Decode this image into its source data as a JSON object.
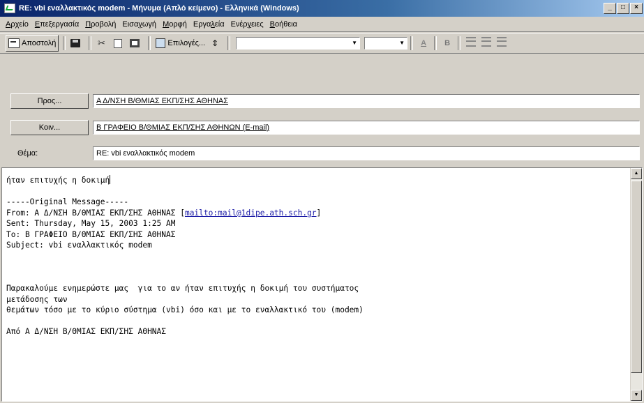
{
  "window": {
    "title": "RE: vbi εναλλακτικός modem - Μήνυμα (Απλό κείμενο) - Ελληνικά (Windows)",
    "controls": {
      "minimize": "_",
      "maximize": "□",
      "close": "×"
    }
  },
  "menu": [
    {
      "pre": "",
      "u": "Α",
      "post": "ρχείο"
    },
    {
      "pre": "",
      "u": "Ε",
      "post": "πεξεργασία"
    },
    {
      "pre": "",
      "u": "Π",
      "post": "ροβολή"
    },
    {
      "pre": "Εισα",
      "u": "γ",
      "post": "ωγή"
    },
    {
      "pre": "",
      "u": "Μ",
      "post": "ορφή"
    },
    {
      "pre": "Εργα",
      "u": "λ",
      "post": "εία"
    },
    {
      "pre": "Ενέρ",
      "u": "γ",
      "post": "ειες"
    },
    {
      "pre": "",
      "u": "Β",
      "post": "οήθεια"
    }
  ],
  "toolbar": {
    "send_label": "Αποστολή",
    "options_label": "Επιλογές...",
    "bold": "B",
    "font_color": "A"
  },
  "recipients": {
    "to_button": "Προς...",
    "to_value": "Α Δ/ΝΣΗ Β/ΘΜΙΑΣ ΕΚΠ/ΣΗΣ ΑΘΗΝΑΣ",
    "cc_button": "Κοιν...",
    "cc_value": "Β ΓΡΑΦΕΙΟ Β/ΘΜΙΑΣ ΕΚΠ/ΣΗΣ ΑΘΗΝΩΝ (E-mail)",
    "subject_label": "Θέμα:",
    "subject_value": "RE: vbi εναλλακτικός modem"
  },
  "message": {
    "line1": "ήταν επιτυχής η δοκιμή",
    "line2": "-----Original Message-----",
    "from_prefix": "From: Α Δ/ΝΣΗ Β/ΘΜΙΑΣ ΕΚΠ/ΣΗΣ ΑΘΗΝΑΣ [",
    "from_link": "mailto:mail@1dipe.ath.sch.gr",
    "from_suffix": "]",
    "sent": "Sent: Thursday, May 15, 2003 1:25 AM",
    "to": "To: Β ΓΡΑΦΕΙΟ Β/ΘΜΙΑΣ ΕΚΠ/ΣΗΣ ΑΘΗΝΑΣ",
    "subject": "Subject: vbi εναλλακτικός modem",
    "para1": "Παρακαλούμε ενημερώστε μας  για το αν ήταν επιτυχής η δοκιμή του συστήματος",
    "para2": "μετάδοσης των",
    "para3": "θεμάτων τόσο με το κύριο σύστημα (vbi) όσο και με το εναλλακτικό του (modem)",
    "sign": "Από Α Δ/ΝΣΗ Β/ΘΜΙΑΣ ΕΚΠ/ΣΗΣ ΑΘΗΝΑΣ"
  }
}
